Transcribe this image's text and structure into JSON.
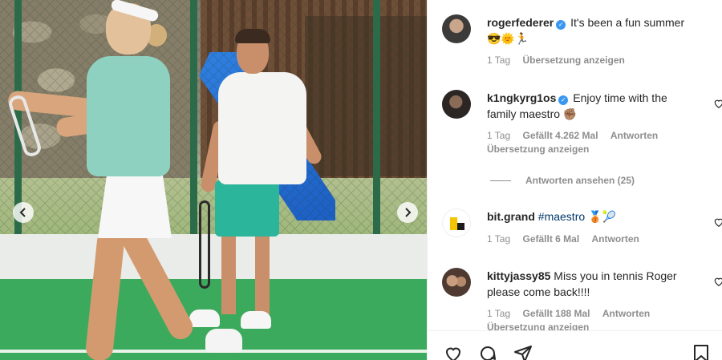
{
  "post": {
    "nav": {
      "prev_icon": "chevron-left-icon",
      "next_icon": "chevron-right-icon"
    }
  },
  "comments": [
    {
      "username": "rogerfederer",
      "verified": true,
      "text": "It's been a fun summer 😎🌞🏃",
      "time": "1 Tag",
      "translate": "Übersetzung anzeigen"
    },
    {
      "username": "k1ngkyrg1os",
      "verified": true,
      "text": "Enjoy time with the family maestro ✊🏽",
      "time": "1 Tag",
      "likes": "Gefällt 4.262 Mal",
      "reply": "Antworten",
      "translate": "Übersetzung anzeigen",
      "view_replies": "Antworten ansehen (25)"
    },
    {
      "username": "bit.grand",
      "verified": false,
      "hashtag": "#maestro",
      "text": "🥉🎾",
      "time": "1 Tag",
      "likes": "Gefällt 6 Mal",
      "reply": "Antworten"
    },
    {
      "username": "kittyjassy85",
      "verified": false,
      "text": "Miss you in tennis Roger please come back!!!!",
      "time": "1 Tag",
      "likes": "Gefällt 188 Mal",
      "reply": "Antworten",
      "translate": "Übersetzung anzeigen"
    }
  ],
  "actions": {
    "like_icon": "heart-icon",
    "comment_icon": "comment-icon",
    "share_icon": "paper-plane-icon",
    "save_icon": "bookmark-icon"
  },
  "colors": {
    "text": "#262626",
    "muted": "#8e8e8e",
    "verified": "#3897f0",
    "hashtag": "#00376b",
    "court_green": "#3caa5c"
  }
}
